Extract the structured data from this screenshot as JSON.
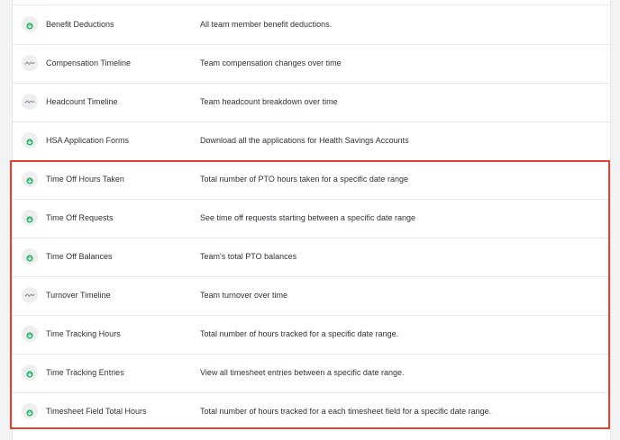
{
  "reports": [
    {
      "name": "Benefit Deductions",
      "description": "All team member benefit deductions.",
      "icon": "download-icon"
    },
    {
      "name": "Compensation Timeline",
      "description": "Team compensation changes over time",
      "icon": "timeline-icon"
    },
    {
      "name": "Headcount Timeline",
      "description": "Team headcount breakdown over time",
      "icon": "timeline-icon"
    },
    {
      "name": "HSA Application Forms",
      "description": "Download all the applications for Health Savings Accounts",
      "icon": "download-icon"
    },
    {
      "name": "Time Off Hours Taken",
      "description": "Total number of PTO hours taken for a specific date range",
      "icon": "download-icon"
    },
    {
      "name": "Time Off Requests",
      "description": "See time off requests starting between a specific date range",
      "icon": "download-icon"
    },
    {
      "name": "Time Off Balances",
      "description": "Team's total PTO balances",
      "icon": "download-icon"
    },
    {
      "name": "Turnover Timeline",
      "description": "Team turnover over time",
      "icon": "timeline-icon"
    },
    {
      "name": "Time Tracking Hours",
      "description": "Total number of hours tracked for a specific date range.",
      "icon": "download-icon"
    },
    {
      "name": "Time Tracking Entries",
      "description": "View all timesheet entries between a specific date range.",
      "icon": "download-icon"
    },
    {
      "name": "Timesheet Field Total Hours",
      "description": "Total number of hours tracked for a each timesheet field for a specific date range.",
      "icon": "download-icon"
    }
  ],
  "colors": {
    "highlight": "#e0432f",
    "download_icon": "#2fb36b",
    "timeline_icon": "#7a8088"
  }
}
